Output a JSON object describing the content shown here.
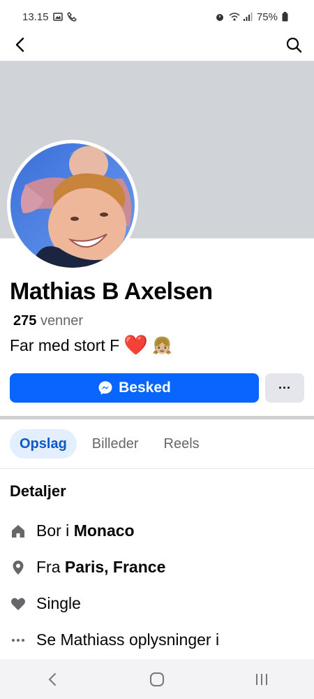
{
  "status_bar": {
    "time": "13.15",
    "battery": "75%"
  },
  "profile": {
    "name": "Mathias B Axelsen",
    "friends_count": "275",
    "friends_label": "venner",
    "bio": "Far med stort F",
    "bio_heart": "❤️",
    "bio_emoji": "👧🏼"
  },
  "actions": {
    "message_label": "Besked",
    "more_label": "···"
  },
  "tabs": [
    {
      "label": "Opslag",
      "active": true
    },
    {
      "label": "Billeder",
      "active": false
    },
    {
      "label": "Reels",
      "active": false
    }
  ],
  "details": {
    "title": "Detaljer",
    "items": [
      {
        "icon": "home-icon",
        "prefix": "Bor i ",
        "bold": "Monaco"
      },
      {
        "icon": "location-pin-icon",
        "prefix": "Fra ",
        "bold": "Paris, France"
      },
      {
        "icon": "heart-icon",
        "prefix": "Single",
        "bold": ""
      },
      {
        "icon": "more-dots-icon",
        "prefix": "Se Mathiass oplysninger i",
        "bold": ""
      }
    ]
  },
  "colors": {
    "accent": "#0866ff",
    "cover": "#d0d3d8",
    "tab_active_bg": "#e3effe"
  }
}
